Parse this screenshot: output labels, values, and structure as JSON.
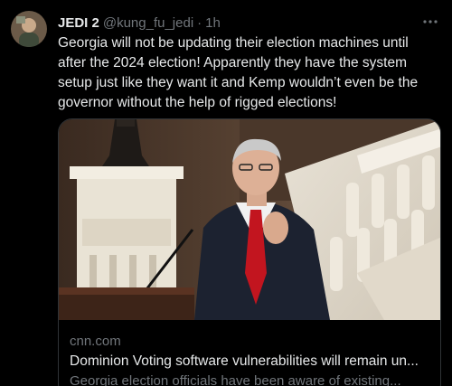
{
  "tweet": {
    "display_name": "JEDI 2",
    "handle": "@kung_fu_jedi",
    "separator": "·",
    "time": "1h",
    "text": "Georgia will not be updating their election machines until\nafter the 2024 election! Apparently they have the system\nsetup just like they want it and Kemp wouldn’t even be the\ngovernor without the help of rigged elections!",
    "more_icon": "more-horizontal-icon"
  },
  "card": {
    "domain": "cnn.com",
    "title": "Dominion Voting software vulnerabilities will remain un...",
    "description": "Georgia election officials have been aware of existing..."
  }
}
